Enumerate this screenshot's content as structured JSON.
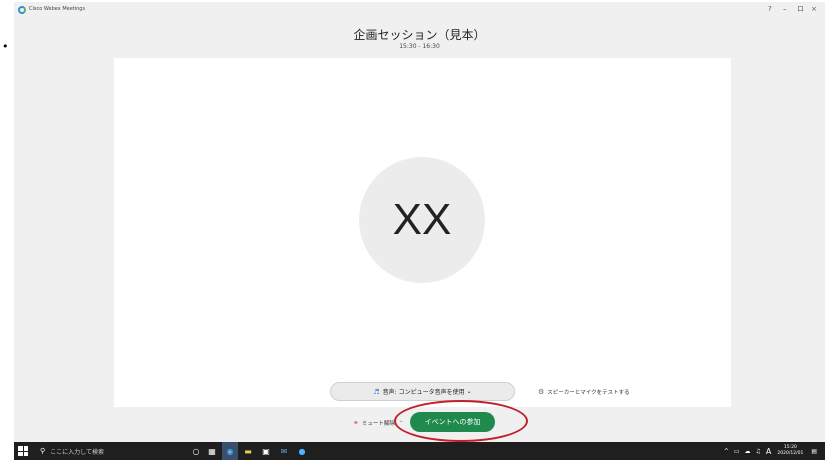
{
  "app": {
    "title": "Cisco Webex Meetings"
  },
  "window_controls": {
    "help": "?",
    "minimize": "–",
    "restore": "ロ",
    "close": "×"
  },
  "meeting": {
    "title": "企画セッション（見本）",
    "time": "15:30 - 16:30"
  },
  "preview": {
    "initials": "XX"
  },
  "audio": {
    "label": "音声: コンピュータ音声を使用",
    "caret": "⌄"
  },
  "speaker_test": {
    "label": "スピーカーとマイクをテストする"
  },
  "controls": {
    "mute_label": "ミュート解除",
    "mute_caret": "⌄",
    "join_label": "イベントへの参加"
  },
  "taskbar": {
    "search_placeholder": "ここに入力して検索",
    "tray_ime": "A",
    "clock_time": "15:20",
    "clock_date": "2020/12/01"
  },
  "colors": {
    "join_green": "#1f8a4c",
    "annotation_red": "#c0202a",
    "taskbar_bg": "#1f1f1f"
  }
}
